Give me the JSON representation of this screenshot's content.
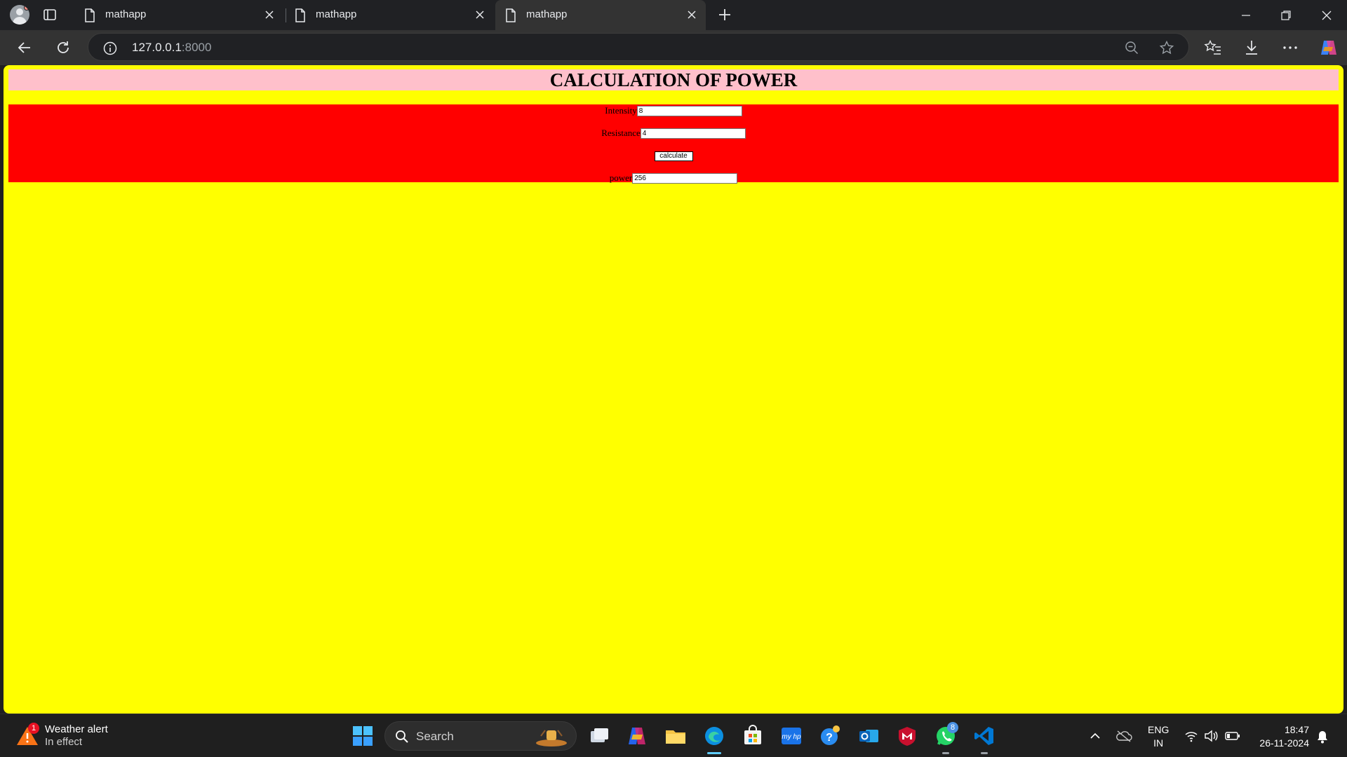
{
  "browser": {
    "tabs": [
      {
        "title": "mathapp",
        "active": false
      },
      {
        "title": "mathapp",
        "active": false
      },
      {
        "title": "mathapp",
        "active": true
      }
    ],
    "url_host": "127.0.0.1",
    "url_port": ":8000"
  },
  "page": {
    "title": "CALCULATION OF POWER",
    "background_color": "#ffff00",
    "title_bg_color": "#ffc0cb",
    "panel_bg_color": "#ff0000",
    "fields": {
      "intensity_label": "Intensity",
      "intensity_value": "8",
      "resistance_label": "Resistance",
      "resistance_value": "4",
      "button_label": "calculate",
      "power_label": "power",
      "power_value": "256"
    }
  },
  "taskbar": {
    "weather_title": "Weather alert",
    "weather_subtitle": "In effect",
    "weather_badge": "1",
    "search_label": "Search",
    "whatsapp_badge": "8",
    "lang_line1": "ENG",
    "lang_line2": "IN",
    "time": "18:47",
    "date": "26-11-2024"
  }
}
